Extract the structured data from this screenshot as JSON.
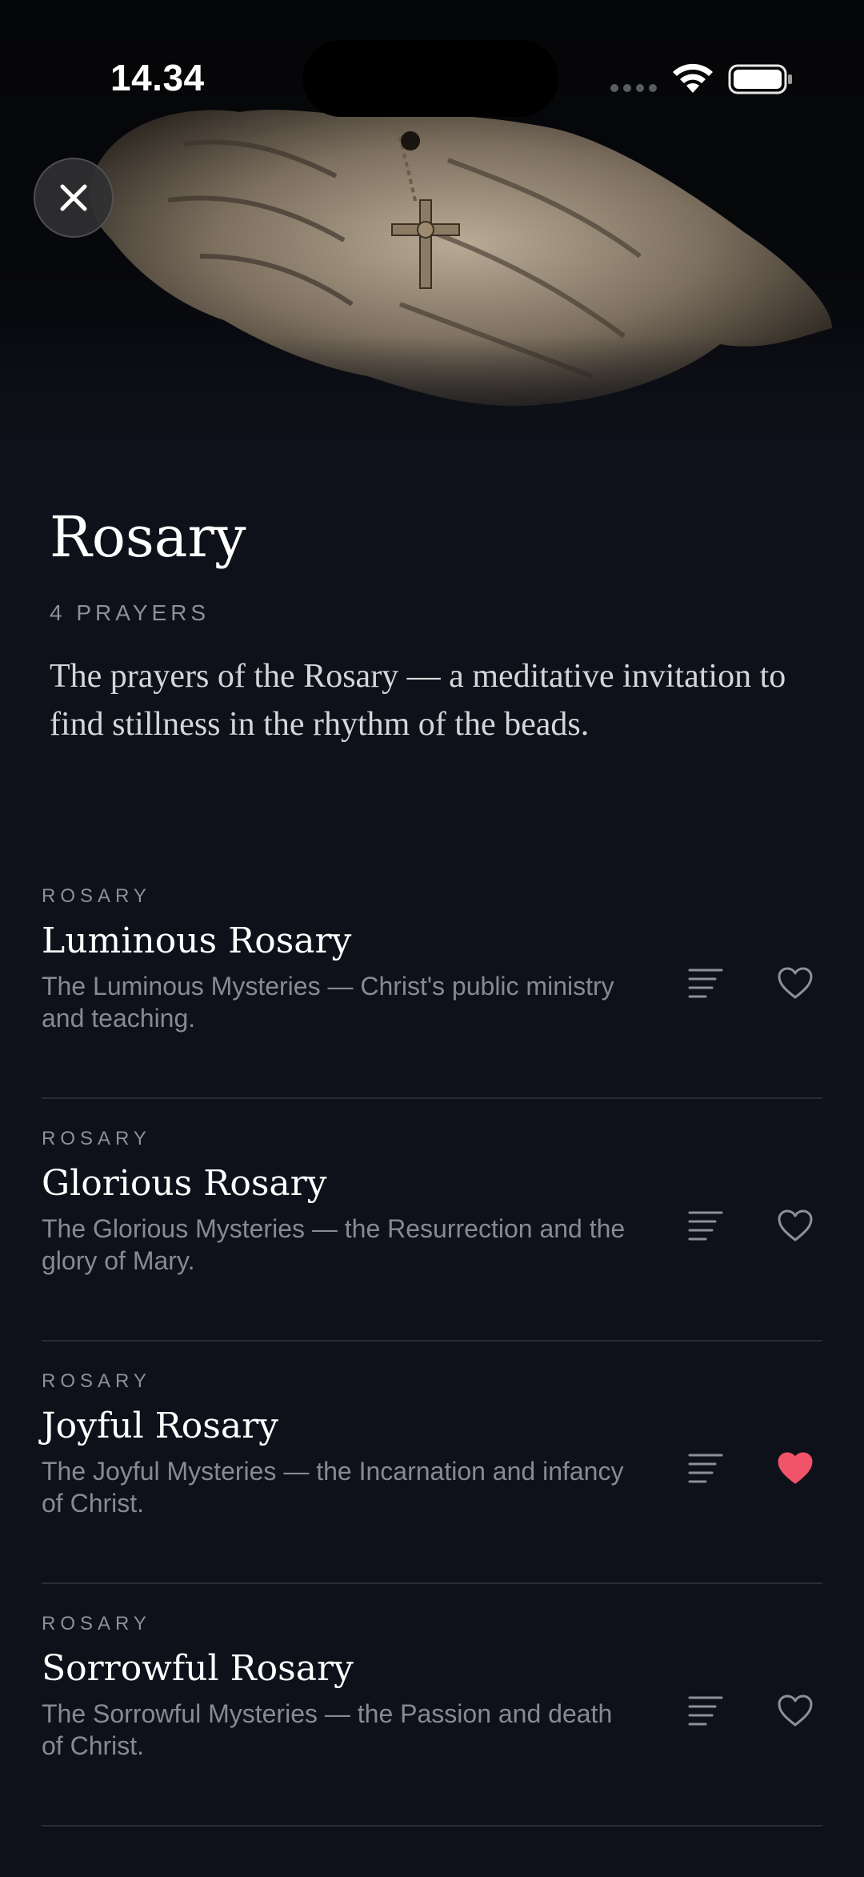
{
  "status_bar": {
    "time": "14.34"
  },
  "hero": {
    "image": "praying-hands-with-rosary-crucifix"
  },
  "header": {
    "title": "Rosary",
    "count_label": "4 PRAYERS",
    "description": "The prayers of the Rosary — a meditative invitation to find stillness in the rhythm of the beads."
  },
  "colors": {
    "background": "#0f111a",
    "favorite_active": "#f0536a",
    "muted_text": "#888a93",
    "divider": "#2a2d36"
  },
  "prayers": [
    {
      "category": "ROSARY",
      "title": "Luminous Rosary",
      "description": "The Luminous Mysteries — Christ's public ministry and teaching.",
      "favorited": false
    },
    {
      "category": "ROSARY",
      "title": "Glorious Rosary",
      "description": "The Glorious Mysteries — the Resurrection and the glory of Mary.",
      "favorited": false
    },
    {
      "category": "ROSARY",
      "title": "Joyful Rosary",
      "description": "The Joyful Mysteries — the Incarnation and infancy of Christ.",
      "favorited": true
    },
    {
      "category": "ROSARY",
      "title": "Sorrowful Rosary",
      "description": "The Sorrowful Mysteries — the Passion and death of Christ.",
      "favorited": false
    }
  ]
}
